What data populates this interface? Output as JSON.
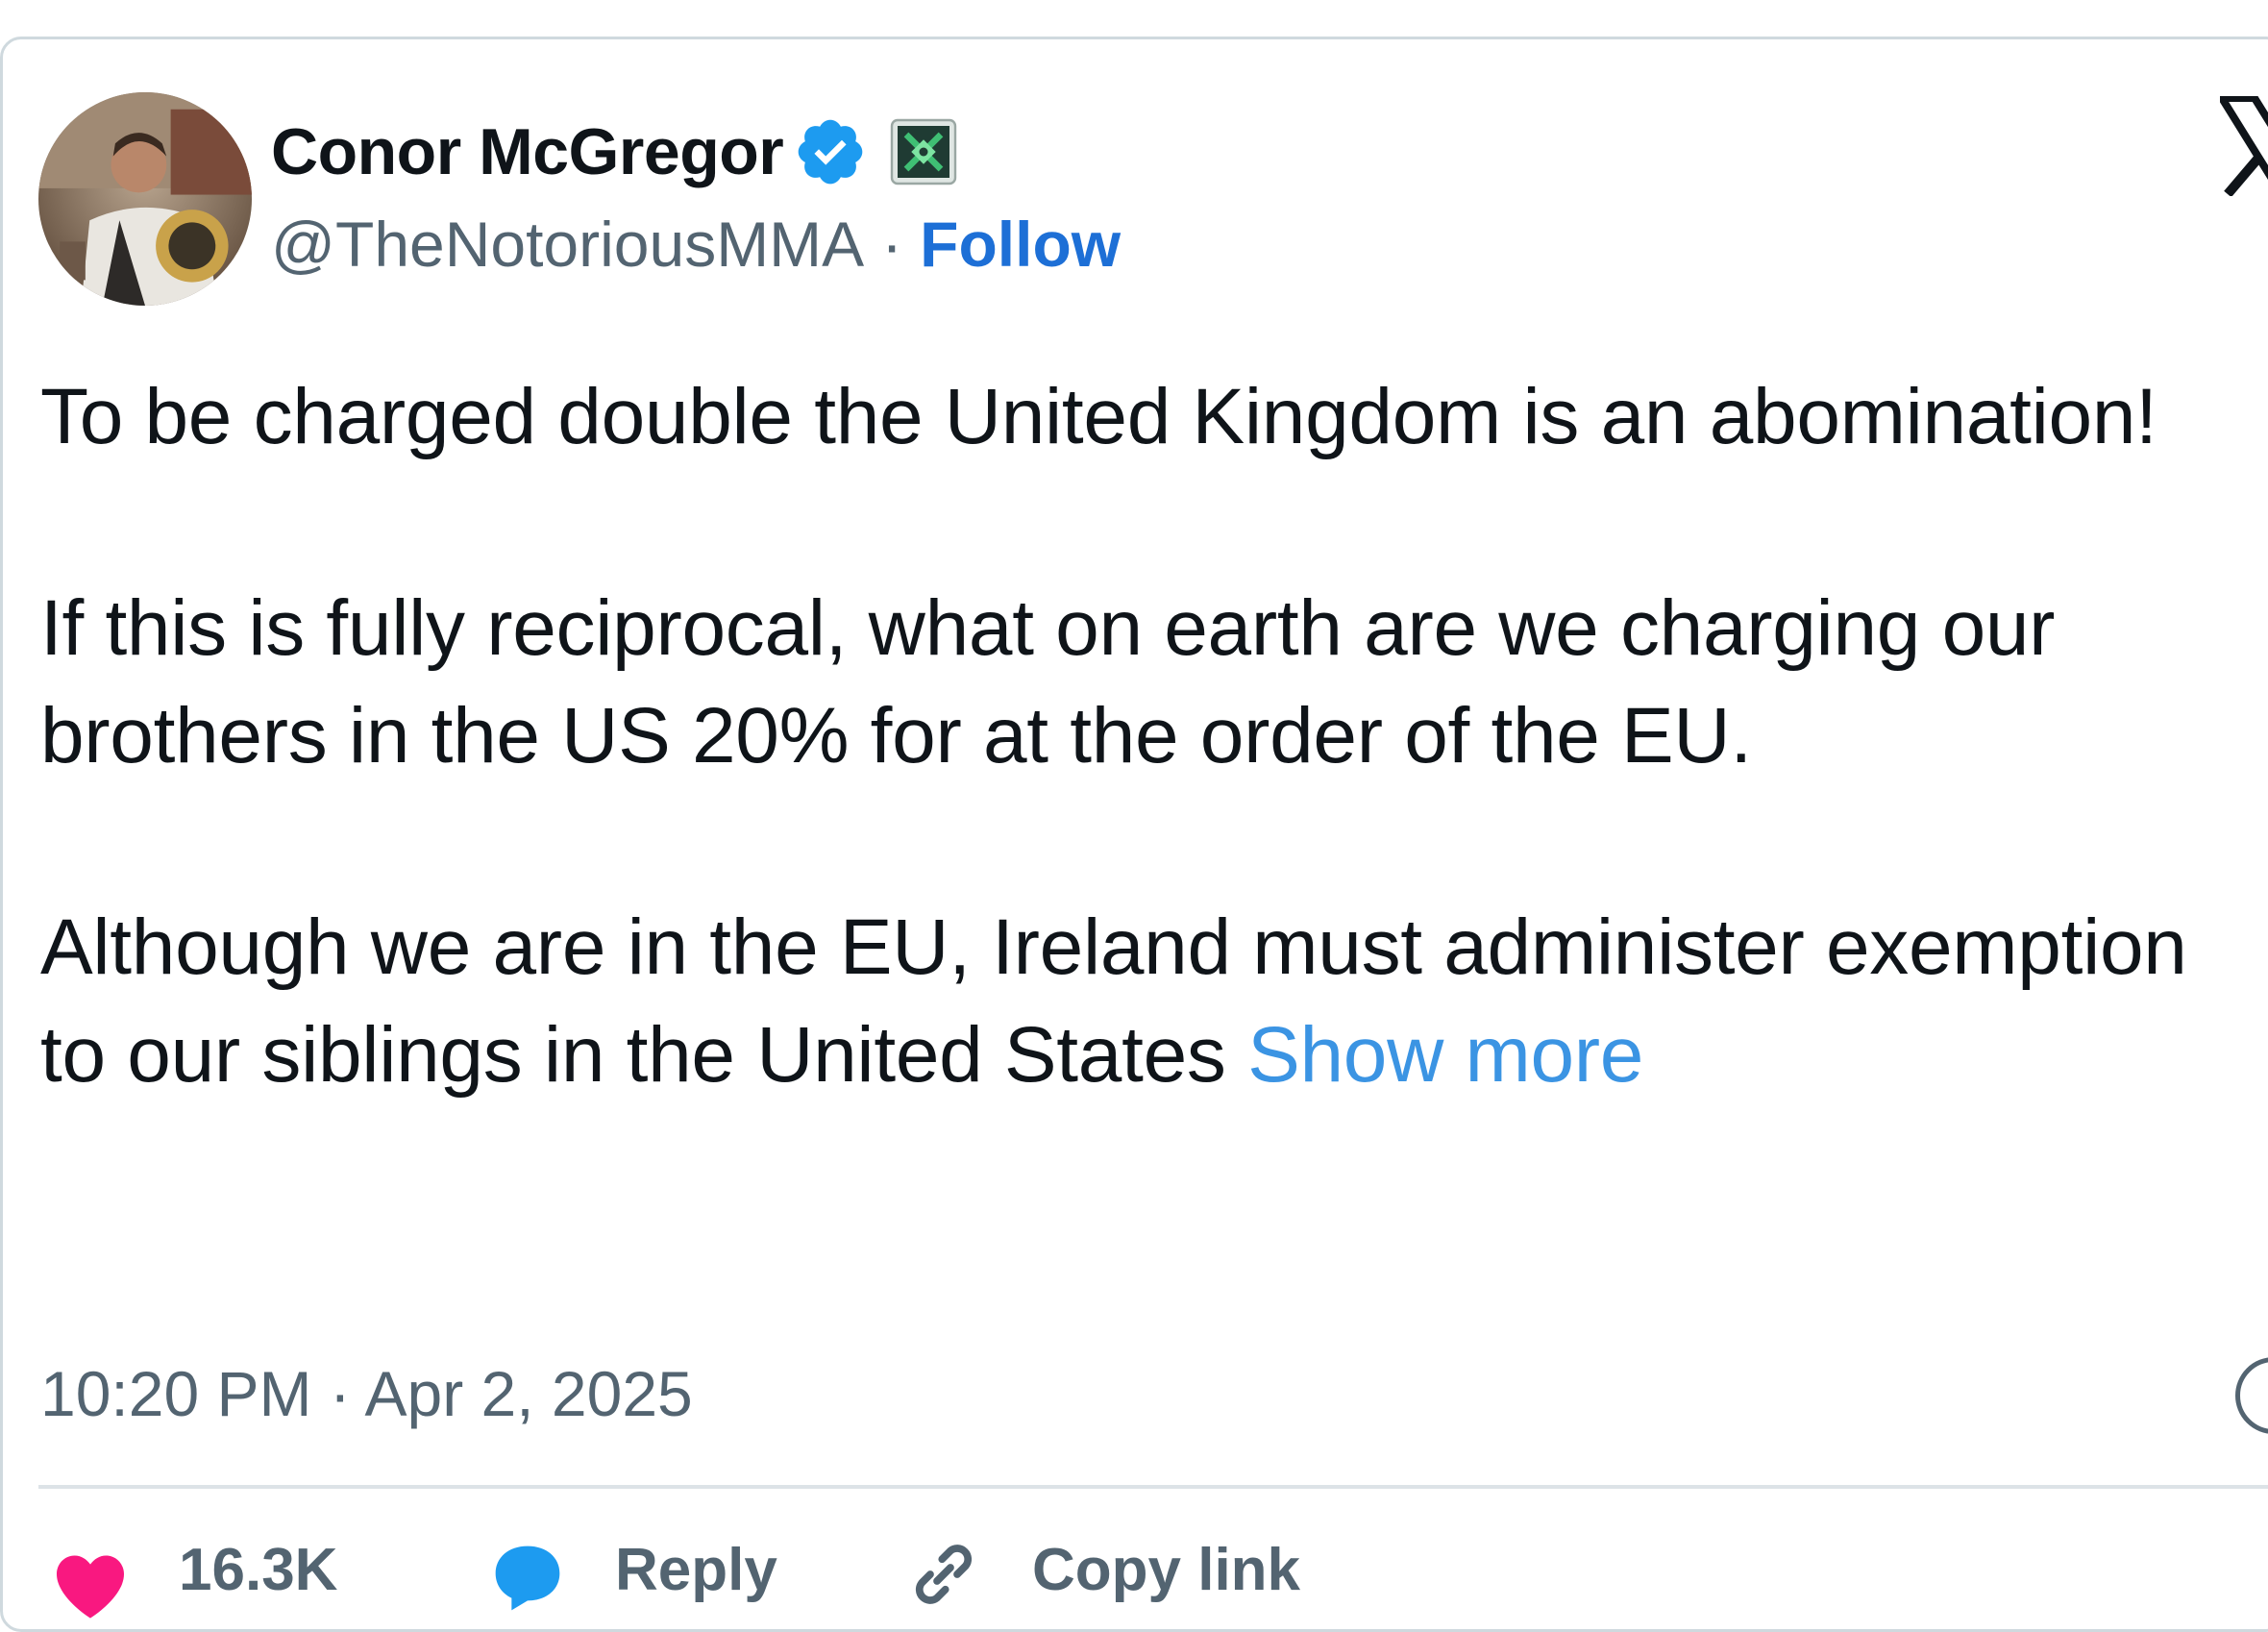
{
  "author": {
    "display_name": "Conor McGregor",
    "handle": "@TheNotoriousMMA",
    "separator": "·",
    "follow_label": "Follow",
    "verified": true,
    "affiliate_badge": "affiliate-badge-icon"
  },
  "tweet": {
    "paragraphs": [
      "To be charged double the United Kingdom is an abomination!",
      "If this is fully reciprocal, what on earth are we charging our brothers in the US 20% for at the order of the EU.",
      "Although we are in the EU, Ireland must administer exemption to our siblings in the United States"
    ],
    "show_more_label": "Show more",
    "timestamp": "10:20 PM · Apr 2, 2025"
  },
  "actions": {
    "likes": "16.3K",
    "reply_label": "Reply",
    "copy_link_label": "Copy link"
  },
  "colors": {
    "text": "#0f1419",
    "secondary": "#536471",
    "link": "#1d9bf0",
    "like": "#f91880",
    "border": "#cfd9de"
  }
}
